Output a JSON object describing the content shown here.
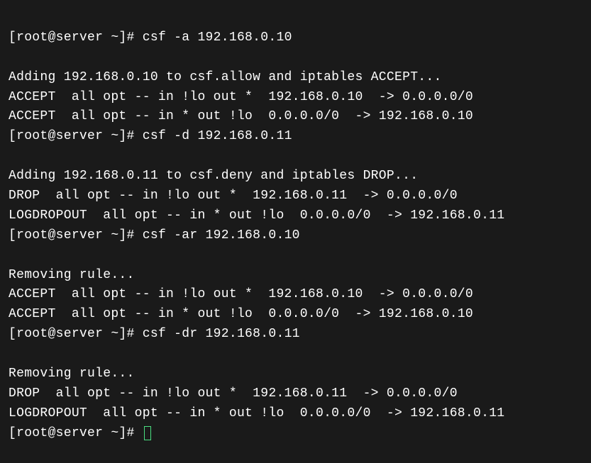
{
  "prompt": "[root@server ~]# ",
  "cmd1": "csf -a 192.168.0.10",
  "out1a": "Adding 192.168.0.10 to csf.allow and iptables ACCEPT...",
  "out1b": "ACCEPT  all opt -- in !lo out *  192.168.0.10  -> 0.0.0.0/0",
  "out1c": "ACCEPT  all opt -- in * out !lo  0.0.0.0/0  -> 192.168.0.10",
  "cmd2": "csf -d 192.168.0.11",
  "out2a": "Adding 192.168.0.11 to csf.deny and iptables DROP...",
  "out2b": "DROP  all opt -- in !lo out *  192.168.0.11  -> 0.0.0.0/0",
  "out2c": "LOGDROPOUT  all opt -- in * out !lo  0.0.0.0/0  -> 192.168.0.11",
  "cmd3": "csf -ar 192.168.0.10",
  "out3a": "Removing rule...",
  "out3b": "ACCEPT  all opt -- in !lo out *  192.168.0.10  -> 0.0.0.0/0",
  "out3c": "ACCEPT  all opt -- in * out !lo  0.0.0.0/0  -> 192.168.0.10",
  "cmd4": "csf -dr 192.168.0.11",
  "out4a": "Removing rule...",
  "out4b": "DROP  all opt -- in !lo out *  192.168.0.11  -> 0.0.0.0/0",
  "out4c": "LOGDROPOUT  all opt -- in * out !lo  0.0.0.0/0  -> 192.168.0.11"
}
